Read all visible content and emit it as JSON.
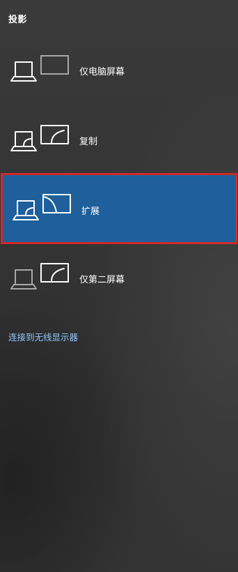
{
  "panel": {
    "title": "投影"
  },
  "options": [
    {
      "label": "仅电脑屏幕",
      "icon": "pc-screen-only-icon",
      "selected": false
    },
    {
      "label": "复制",
      "icon": "duplicate-icon",
      "selected": false
    },
    {
      "label": "扩展",
      "icon": "extend-icon",
      "selected": true
    },
    {
      "label": "仅第二屏幕",
      "icon": "second-screen-only-icon",
      "selected": false
    }
  ],
  "wireless_link": "连接到无线显示器",
  "colors": {
    "selected_background": "#1e5f9c",
    "selected_border": "#d22a2a",
    "link": "#8fc6ff"
  }
}
